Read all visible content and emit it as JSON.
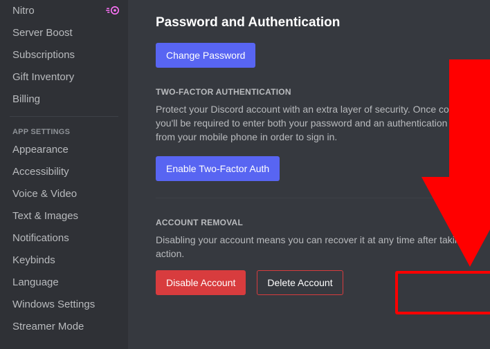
{
  "sidebar": {
    "items_top": [
      {
        "label": "Nitro",
        "badge": true
      },
      {
        "label": "Server Boost"
      },
      {
        "label": "Subscriptions"
      },
      {
        "label": "Gift Inventory"
      },
      {
        "label": "Billing"
      }
    ],
    "section_app": "APP SETTINGS",
    "items_app": [
      {
        "label": "Appearance"
      },
      {
        "label": "Accessibility"
      },
      {
        "label": "Voice & Video"
      },
      {
        "label": "Text & Images"
      },
      {
        "label": "Notifications"
      },
      {
        "label": "Keybinds"
      },
      {
        "label": "Language"
      },
      {
        "label": "Windows Settings"
      },
      {
        "label": "Streamer Mode"
      }
    ]
  },
  "main": {
    "heading": "Password and Authentication",
    "change_password": "Change Password",
    "tfa_title": "TWO-FACTOR AUTHENTICATION",
    "tfa_text": "Protect your Discord account with an extra layer of security. Once configured, you'll be required to enter both your password and an authentication code from your mobile phone in order to sign in.",
    "tfa_button": "Enable Two-Factor Auth",
    "removal_title": "ACCOUNT REMOVAL",
    "removal_text": "Disabling your account means you can recover it at any time after taking this action.",
    "disable_button": "Disable Account",
    "delete_button": "Delete Account"
  }
}
